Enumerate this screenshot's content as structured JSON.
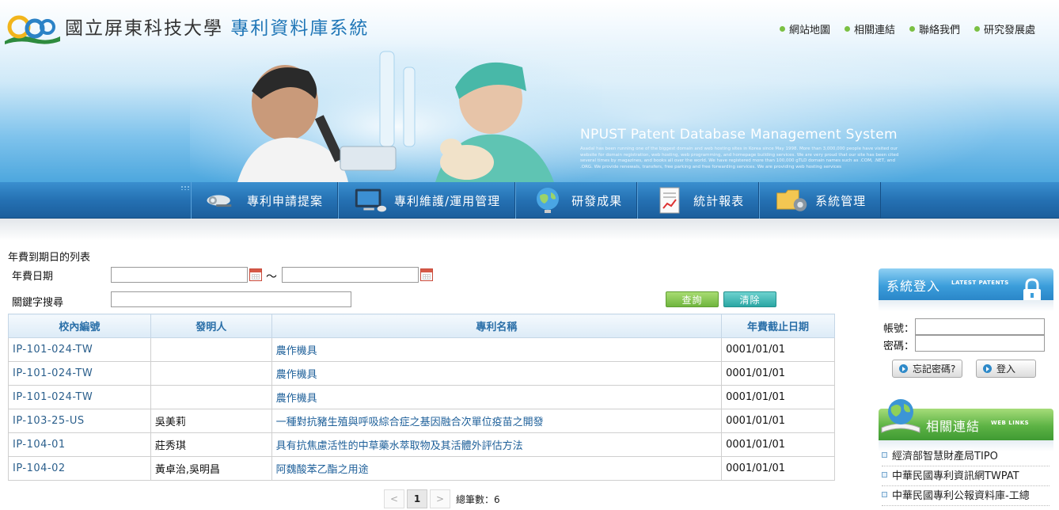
{
  "header": {
    "title_main": "國立屏東科技大學",
    "title_accent": "專利資料庫系統",
    "top_links": [
      "網站地圖",
      "相關連結",
      "聯絡我們",
      "研究發展處"
    ],
    "english_title": "NPUST Patent Database Management System",
    "english_blurb": "Asadal has been running one of the biggest domain and web hosting sites in Korea since May 1998. More than 3,000,000 people have visited our website for domain registration, web hosting, web programming, and homepage building services. We are very proud that our site has been cited several times by magazines, and books all over the world. We have registered more than 100,000 gTLD domain names such as .COM, .NET, and .ORG. We provide renewals, transfers, free parking and free forwarding services. We are providing web hosting services"
  },
  "nav": {
    "items": [
      {
        "label": "專利申請提案",
        "icon": "projector-icon"
      },
      {
        "label": "專利維護/運用管理",
        "icon": "monitor-icon"
      },
      {
        "label": "研發成果",
        "icon": "globe-icon"
      },
      {
        "label": "統計報表",
        "icon": "report-icon"
      },
      {
        "label": "系統管理",
        "icon": "folder-gear-icon"
      }
    ]
  },
  "search": {
    "heading": "年費到期日的列表",
    "date_label": "年費日期",
    "range_sep": "～",
    "keyword_label": "關鍵字搜尋",
    "query_button": "查詢",
    "clear_button": "清除"
  },
  "table": {
    "columns": [
      "校內編號",
      "發明人",
      "專利名稱",
      "年費截止日期"
    ],
    "rows": [
      {
        "id": "IP-101-024-TW",
        "inventor": "",
        "name": "農作機具",
        "due": "0001/01/01"
      },
      {
        "id": "IP-101-024-TW",
        "inventor": "",
        "name": "農作機具",
        "due": "0001/01/01"
      },
      {
        "id": "IP-101-024-TW",
        "inventor": "",
        "name": "農作機具",
        "due": "0001/01/01"
      },
      {
        "id": "IP-103-25-US",
        "inventor": "吳美莉",
        "name": "一種對抗豬生殖與呼吸綜合症之基因融合次單位疫苗之開發",
        "due": "0001/01/01"
      },
      {
        "id": "IP-104-01",
        "inventor": "莊秀琪",
        "name": "具有抗焦慮活性的中草藥水萃取物及其活體外評估方法",
        "due": "0001/01/01"
      },
      {
        "id": "IP-104-02",
        "inventor": "黃卓治,吳明昌",
        "name": "阿魏酸苯乙酯之用途",
        "due": "0001/01/01"
      }
    ]
  },
  "pager": {
    "prev": "<",
    "current": "1",
    "next": ">",
    "total_label": "總筆數：",
    "total": "6"
  },
  "sidebar": {
    "login_title": "系統登入",
    "login_sub": "LATEST PATENTS",
    "account_label": "帳號：",
    "password_label": "密碼：",
    "forgot_button": "忘記密碼?",
    "login_button": "登入",
    "links_title": "相關連結",
    "links_sub": "WEB LINKS",
    "links": [
      "經濟部智慧財產局TIPO",
      "中華民國專利資訊網TWPAT",
      "中華民國專利公報資料庫-工總"
    ]
  }
}
